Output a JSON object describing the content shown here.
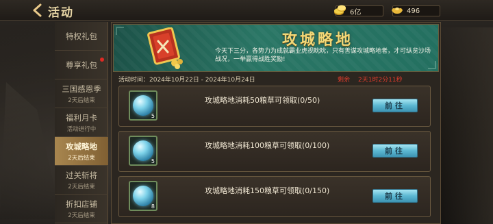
{
  "header": {
    "title": "活动",
    "back_icon": "back-arrow-icon"
  },
  "currency": {
    "gold": {
      "icon": "gold-coin-icon",
      "value": "6亿"
    },
    "ingot": {
      "icon": "gold-ingot-icon",
      "value": "496"
    }
  },
  "sidebar": {
    "items": [
      {
        "label": "特权礼包",
        "sub": "",
        "badge": false
      },
      {
        "label": "尊享礼包",
        "sub": "",
        "badge": true
      },
      {
        "label": "三国感恩季",
        "sub": "2天后结束",
        "badge": false
      },
      {
        "label": "福利月卡",
        "sub": "活动进行中",
        "badge": false
      },
      {
        "label": "攻城略地",
        "sub": "2天后结束",
        "badge": false,
        "active": true
      },
      {
        "label": "过关斩将",
        "sub": "2天后结束",
        "badge": false
      },
      {
        "label": "折扣店铺",
        "sub": "2天后结束",
        "badge": false
      }
    ]
  },
  "banner": {
    "title": "攻城略地",
    "description": "今天下三分，各势力为成就霸业虎视眈眈，只有善谋攻城略地者，才可纵览沙场战况，一举赢得战胜奖励!"
  },
  "event_time": {
    "label": "活动时间：2024年10月22日 - 2024年10月24日",
    "remain_label": "剩余",
    "remain_value": "2天1时2分11秒"
  },
  "tasks": [
    {
      "text": "攻城略地消耗50粮草可领取(0/50)",
      "reward_count": "5",
      "button": "前往"
    },
    {
      "text": "攻城略地消耗100粮草可领取(0/100)",
      "reward_count": "5",
      "button": "前往"
    },
    {
      "text": "攻城略地消耗150粮草可领取(0/150)",
      "reward_count": "8",
      "button": "前往"
    }
  ],
  "colors": {
    "accent_gold": "#f2d878",
    "remain_red": "#e03c2c",
    "button_blue": "#5cb8d2",
    "active_tab": "#a8864f"
  }
}
